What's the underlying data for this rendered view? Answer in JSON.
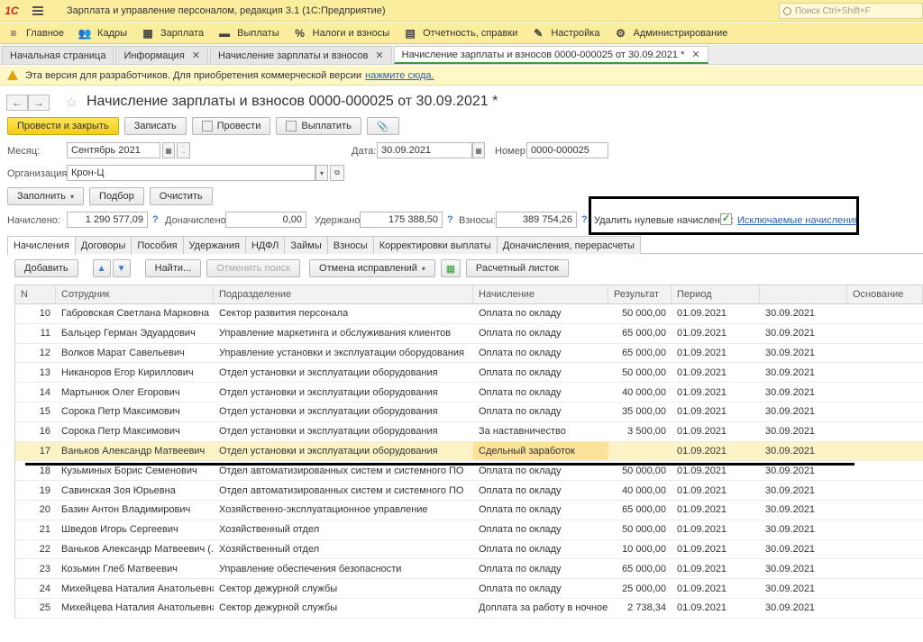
{
  "app": {
    "logo": "1С",
    "title": "Зарплата и управление персоналом, редакция 3.1  (1С:Предприятие)",
    "search_placeholder": "Поиск Ctrl+Shift+F"
  },
  "sections": [
    {
      "label": "Главное",
      "icon": "menu-icon",
      "glyph": "≡"
    },
    {
      "label": "Кадры",
      "icon": "people-icon",
      "glyph": "👥"
    },
    {
      "label": "Зарплата",
      "icon": "calculator-icon",
      "glyph": "▦"
    },
    {
      "label": "Выплаты",
      "icon": "wallet-icon",
      "glyph": "▬"
    },
    {
      "label": "Налоги и взносы",
      "icon": "percent-icon",
      "glyph": "%"
    },
    {
      "label": "Отчетность, справки",
      "icon": "report-icon",
      "glyph": "▤"
    },
    {
      "label": "Настройка",
      "icon": "wrench-icon",
      "glyph": "✎"
    },
    {
      "label": "Администрирование",
      "icon": "gear-icon",
      "glyph": "⚙"
    }
  ],
  "open_tabs": [
    {
      "label": "Начальная страница",
      "closable": false
    },
    {
      "label": "Информация",
      "closable": true
    },
    {
      "label": "Начисление зарплаты и взносов",
      "closable": true
    },
    {
      "label": "Начисление зарплаты и взносов 0000-000025 от 30.09.2021 *",
      "closable": true,
      "active": true
    }
  ],
  "banner": {
    "text": "Эта версия для разработчиков. Для приобретения коммерческой версии",
    "link": "нажмите сюда."
  },
  "form": {
    "title": "Начисление зарплаты и взносов 0000-000025 от 30.09.2021 *",
    "buttons": {
      "post_close": "Провести и закрыть",
      "save": "Записать",
      "post": "Провести",
      "pay": "Выплатить"
    },
    "month_label": "Месяц:",
    "month_value": "Сентябрь 2021",
    "date_label": "Дата:",
    "date_value": "30.09.2021",
    "number_label": "Номер:",
    "number_value": "0000-000025",
    "org_label": "Организация:",
    "org_value": "Крон-Ц",
    "fill_button": "Заполнить",
    "select_button": "Подбор",
    "clear_button": "Очистить",
    "accrued_label": "Начислено:",
    "accrued_value": "1 290 577,09",
    "extra_label": "Доначислено:",
    "extra_value": "0,00",
    "withheld_label": "Удержано:",
    "withheld_value": "175 388,50",
    "contrib_label": "Взносы:",
    "contrib_value": "389 754,26",
    "remove_zero_label": "Удалить нулевые начисления:",
    "remove_zero_checked": true,
    "excluded_link": "Исключаемые начисления"
  },
  "inner_tabs": [
    "Начисления",
    "Договоры",
    "Пособия",
    "Удержания",
    "НДФЛ",
    "Займы",
    "Взносы",
    "Корректировки выплаты",
    "Доначисления, перерасчеты"
  ],
  "table_toolbar": {
    "add": "Добавить",
    "find": "Найти...",
    "cancel_search": "Отменить поиск",
    "cancel_fixes": "Отмена исправлений",
    "payslip": "Расчетный листок"
  },
  "table": {
    "columns": [
      "N",
      "Сотрудник",
      "Подразделение",
      "Начисление",
      "Результат",
      "Период",
      "",
      "Основание"
    ],
    "selected_row": 7,
    "rows": [
      [
        "10",
        "Габровская Светлана Марковна",
        "Сектор развития персонала",
        "Оплата по окладу",
        "50 000,00",
        "01.09.2021",
        "30.09.2021",
        ""
      ],
      [
        "11",
        "Бальцер Герман Эдуардович",
        "Управление маркетинга и обслуживания клиентов",
        "Оплата по окладу",
        "65 000,00",
        "01.09.2021",
        "30.09.2021",
        ""
      ],
      [
        "12",
        "Волков Марат Савельевич",
        "Управление установки и эксплуатации оборудования",
        "Оплата по окладу",
        "65 000,00",
        "01.09.2021",
        "30.09.2021",
        ""
      ],
      [
        "13",
        "Никаноров Егор Кириллович",
        "Отдел установки и эксплуатации оборудования",
        "Оплата по окладу",
        "50 000,00",
        "01.09.2021",
        "30.09.2021",
        ""
      ],
      [
        "14",
        "Мартынюк Олег Егорович",
        "Отдел установки и эксплуатации оборудования",
        "Оплата по окладу",
        "40 000,00",
        "01.09.2021",
        "30.09.2021",
        ""
      ],
      [
        "15",
        "Сорока Петр Максимович",
        "Отдел установки и эксплуатации оборудования",
        "Оплата по окладу",
        "35 000,00",
        "01.09.2021",
        "30.09.2021",
        ""
      ],
      [
        "16",
        "Сорока Петр Максимович",
        "Отдел установки и эксплуатации оборудования",
        "За наставничество",
        "3 500,00",
        "01.09.2021",
        "30.09.2021",
        ""
      ],
      [
        "17",
        "Ваньков Александр Матвеевич",
        "Отдел установки и эксплуатации оборудования",
        "Сдельный заработок",
        "",
        "01.09.2021",
        "30.09.2021",
        ""
      ],
      [
        "18",
        "Кузьминых Борис Семенович",
        "Отдел автоматизированных систем и системного ПО",
        "Оплата по окладу",
        "50 000,00",
        "01.09.2021",
        "30.09.2021",
        ""
      ],
      [
        "19",
        "Савинская Зоя Юрьевна",
        "Отдел автоматизированных систем и системного ПО",
        "Оплата по окладу",
        "40 000,00",
        "01.09.2021",
        "30.09.2021",
        ""
      ],
      [
        "20",
        "Базин Антон Владимирович",
        "Хозяйственно-эксплуатационное управление",
        "Оплата по окладу",
        "65 000,00",
        "01.09.2021",
        "30.09.2021",
        ""
      ],
      [
        "21",
        "Шведов Игорь Сергеевич",
        "Хозяйственный отдел",
        "Оплата по окладу",
        "50 000,00",
        "01.09.2021",
        "30.09.2021",
        ""
      ],
      [
        "22",
        "Ваньков Александр Матвеевич (...",
        "Хозяйственный отдел",
        "Оплата по окладу",
        "10 000,00",
        "01.09.2021",
        "30.09.2021",
        ""
      ],
      [
        "23",
        "Козьмин Глеб Матвеевич",
        "Управление обеспечения безопасности",
        "Оплата по окладу",
        "65 000,00",
        "01.09.2021",
        "30.09.2021",
        ""
      ],
      [
        "24",
        "Михейцева Наталия Анатольевна",
        "Сектор дежурной службы",
        "Оплата по окладу",
        "25 000,00",
        "01.09.2021",
        "30.09.2021",
        ""
      ],
      [
        "25",
        "Михейцева Наталия Анатольевна",
        "Сектор дежурной службы",
        "Доплата за работу в ночное ...",
        "2 738,34",
        "01.09.2021",
        "30.09.2021",
        ""
      ]
    ]
  }
}
